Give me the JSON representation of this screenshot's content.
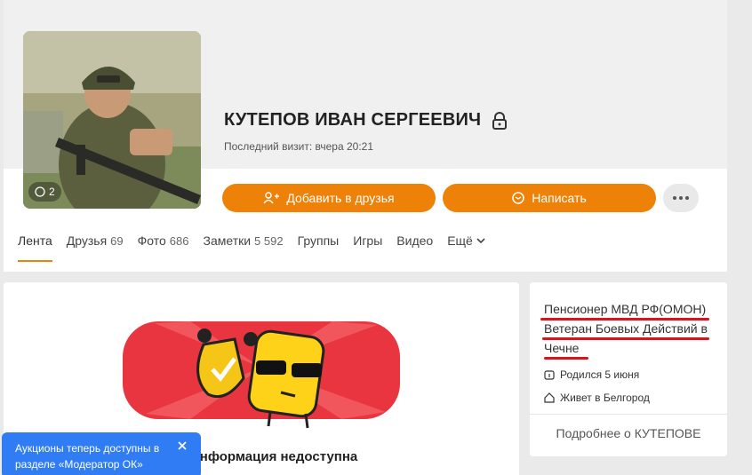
{
  "profile": {
    "name": "КУТЕПОВ ИВАН СЕРГЕЕВИЧ",
    "last_visit": "Последний визит: вчера 20:21",
    "photo_count": "2"
  },
  "actions": {
    "add_friend": "Добавить в друзья",
    "write": "Написать"
  },
  "tabs": [
    {
      "label": "Лента",
      "count": ""
    },
    {
      "label": "Друзья",
      "count": "69"
    },
    {
      "label": "Фото",
      "count": "686"
    },
    {
      "label": "Заметки",
      "count": "5 592"
    },
    {
      "label": "Группы",
      "count": ""
    },
    {
      "label": "Игры",
      "count": ""
    },
    {
      "label": "Видео",
      "count": ""
    },
    {
      "label": "Ещё",
      "count": ""
    }
  ],
  "feed": {
    "unavailable": "Информация недоступна"
  },
  "info": {
    "status_lines": [
      "Пенсионер МВД РФ(ОМОН)",
      "Ветеран Боевых Действий в",
      "Чечне"
    ],
    "birthday": "Родился 5 июня",
    "lives": "Живет в Белгород",
    "more": "Подробнее о КУТЕПОВЕ"
  },
  "toast": {
    "text": "Аукционы теперь доступны в разделе «Модератор ОК»"
  },
  "colors": {
    "accent": "#ee8208",
    "toast": "#2f7cf5",
    "highlight": "#d8141c"
  }
}
